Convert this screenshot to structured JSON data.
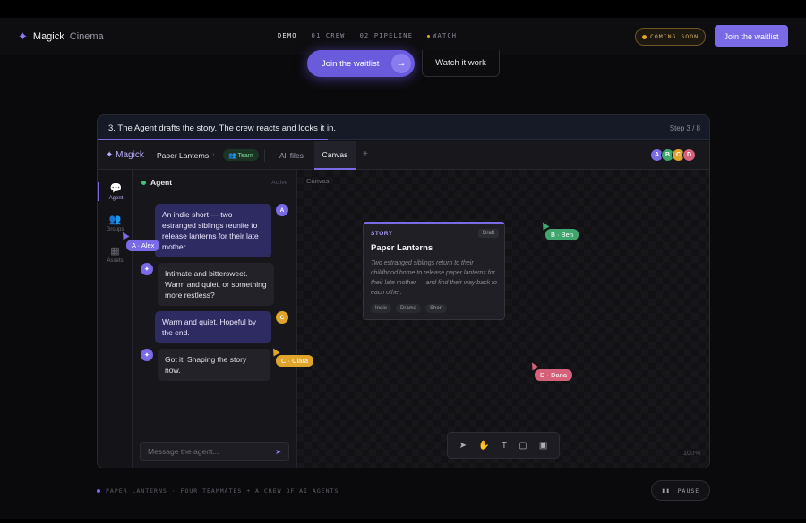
{
  "nav": {
    "brand_primary": "Magick",
    "brand_secondary": "Cinema",
    "links": [
      "DEMO",
      "01 CREW",
      "02 PIPELINE",
      "WATCH"
    ],
    "coming_soon": "COMING SOON",
    "join_label": "Join the waitlist"
  },
  "hero": {
    "join_label": "Join the waitlist",
    "watch_label": "Watch it work"
  },
  "demo": {
    "step_text": "3. The Agent drafts the story. The crew reacts and locks it in.",
    "step_count": "Step 3 / 8",
    "progress": 0.375,
    "app": {
      "logo": "✦ Magick",
      "project": "Paper Lanterns",
      "team_badge": "👥 Team",
      "tabs": [
        "All files",
        "Canvas"
      ],
      "active_tab": "Canvas",
      "avatars": [
        {
          "letter": "A",
          "color": "#7a6ae6"
        },
        {
          "letter": "B",
          "color": "#3fa66e"
        },
        {
          "letter": "C",
          "color": "#e0a42a"
        },
        {
          "letter": "D",
          "color": "#d4607a"
        }
      ]
    },
    "rail": [
      "Agent",
      "Groups",
      "Assets"
    ],
    "chat": {
      "title": "Agent",
      "status": "Active",
      "messages": [
        {
          "from": "A",
          "text": "An indie short — two estranged siblings reunite to release lanterns for their late mother"
        },
        {
          "from": "agent",
          "text": "Intimate and bittersweet. Warm and quiet, or something more restless?"
        },
        {
          "from": "C",
          "text": "Warm and quiet. Hopeful by the end."
        },
        {
          "from": "agent",
          "text": "Got it. Shaping the story now."
        }
      ],
      "input_placeholder": "Message the agent...",
      "send_icon": "➤"
    },
    "canvas": {
      "label": "Canvas",
      "card": {
        "kicker": "STORY",
        "badge": "Draft",
        "title": "Paper Lanterns",
        "description": "Two estranged siblings return to their childhood home to release paper lanterns for their late mother — and find their way back to each other.",
        "tags": [
          "Indie",
          "Drama",
          "Short"
        ]
      },
      "cursors": [
        {
          "label": "A · Alex",
          "color": "#7a6ae6"
        },
        {
          "label": "B · Ben",
          "color": "#3fa66e"
        },
        {
          "label": "C · Clara",
          "color": "#e0a42a"
        },
        {
          "label": "D · Dana",
          "color": "#d4607a"
        }
      ],
      "tools": [
        "select-icon",
        "hand-icon",
        "text-icon",
        "rectangle-icon",
        "image-icon"
      ],
      "zoom": "100%"
    }
  },
  "footer": {
    "caption": "PAPER LANTERNS · FOUR TEAMMATES + A CREW OF AI AGENTS",
    "pause_label": "PAUSE"
  }
}
